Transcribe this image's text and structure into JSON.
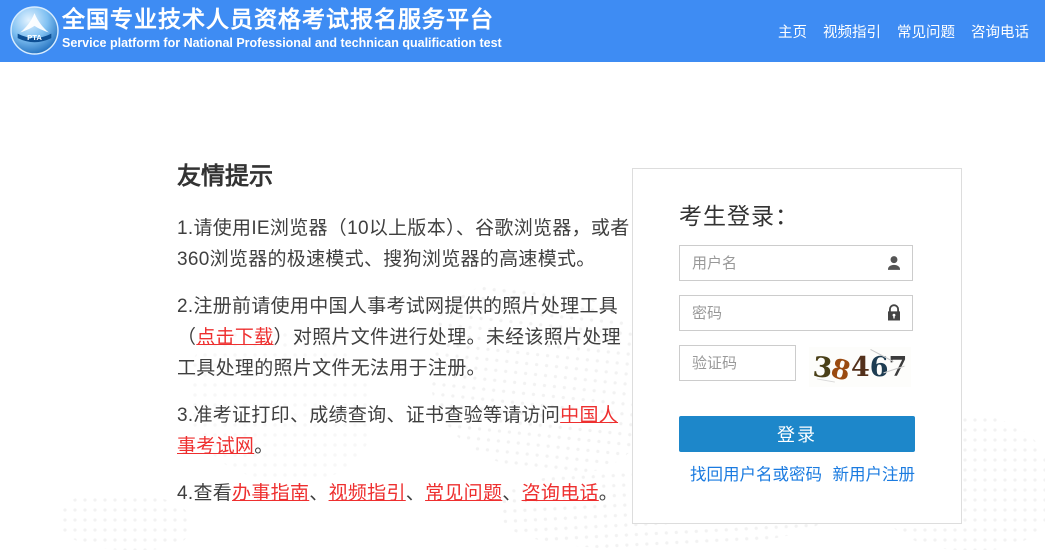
{
  "header": {
    "logo_text": "PTA",
    "title_cn": "全国专业技术人员资格考试报名服务平台",
    "title_en": "Service platform for National Professional and technican qualification test",
    "nav": [
      {
        "label": "主页"
      },
      {
        "label": "视频指引"
      },
      {
        "label": "常见问题"
      },
      {
        "label": "咨询电话"
      }
    ]
  },
  "tips": {
    "heading": "友情提示",
    "items": [
      {
        "segments": [
          {
            "text": "1.请使用IE浏览器（10以上版本）、谷歌浏览器，或者360浏览器的极速模式、搜狗浏览器的高速模式。",
            "link": false
          }
        ]
      },
      {
        "segments": [
          {
            "text": "2.注册前请使用中国人事考试网提供的照片处理工具（",
            "link": false
          },
          {
            "text": "点击下载",
            "link": true
          },
          {
            "text": "）对照片文件进行处理。未经该照片处理工具处理的照片文件无法用于注册。",
            "link": false
          }
        ]
      },
      {
        "segments": [
          {
            "text": "3.准考证打印、成绩查询、证书查验等请访问",
            "link": false
          },
          {
            "text": "中国人事考试网",
            "link": true
          },
          {
            "text": "。",
            "link": false
          }
        ]
      },
      {
        "segments": [
          {
            "text": "4.查看",
            "link": false
          },
          {
            "text": "办事指南",
            "link": true
          },
          {
            "text": "、",
            "link": false
          },
          {
            "text": "视频指引",
            "link": true
          },
          {
            "text": "、",
            "link": false
          },
          {
            "text": "常见问题",
            "link": true
          },
          {
            "text": "、",
            "link": false
          },
          {
            "text": "咨询电话",
            "link": true
          },
          {
            "text": "。",
            "link": false
          }
        ]
      }
    ]
  },
  "login": {
    "heading": "考生登录：",
    "username_placeholder": "用户名",
    "password_placeholder": "密码",
    "captcha_placeholder": "验证码",
    "captcha_digits": [
      {
        "char": "3",
        "color": "#4a4018"
      },
      {
        "char": "8",
        "color": "#9a4a10"
      },
      {
        "char": "4",
        "color": "#53301a"
      },
      {
        "char": "6",
        "color": "#1e3d52"
      },
      {
        "char": "7",
        "color": "#3c3c3c"
      }
    ],
    "login_button": "登录",
    "forgot_link": "找回用户名或密码",
    "register_link": "新用户注册"
  },
  "colors": {
    "header_bg": "#3e8cf3",
    "button_bg": "#1d87ca",
    "link_blue": "#1b7be0",
    "tip_link_red": "#ee2f2f"
  }
}
